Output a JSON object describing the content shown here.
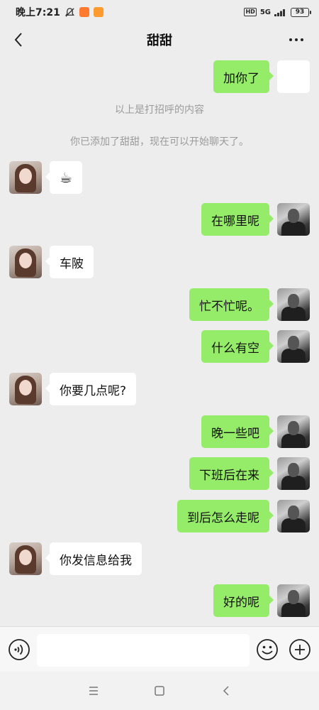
{
  "status_bar": {
    "time": "晚上7:21",
    "network": "5G",
    "hd": "HD",
    "battery": "93"
  },
  "header": {
    "title": "甜甜"
  },
  "messages": [
    {
      "side": "right",
      "text": "加你了",
      "avatar": "blank"
    },
    {
      "side": "system",
      "text": "以上是打招呼的内容"
    },
    {
      "side": "system",
      "text": "你已添加了甜甜，现在可以开始聊天了。"
    },
    {
      "side": "left",
      "text": "☕"
    },
    {
      "side": "right",
      "text": "在哪里呢"
    },
    {
      "side": "left",
      "text": "车陂"
    },
    {
      "side": "right",
      "text": "忙不忙呢。"
    },
    {
      "side": "right",
      "text": "什么有空"
    },
    {
      "side": "left",
      "text": "你要几点呢?"
    },
    {
      "side": "right",
      "text": "晚一些吧"
    },
    {
      "side": "right",
      "text": "下班后在来"
    },
    {
      "side": "right",
      "text": "到后怎么走呢"
    },
    {
      "side": "left",
      "text": "你发信息给我"
    },
    {
      "side": "right",
      "text": "好的呢"
    }
  ],
  "input": {
    "value": "",
    "placeholder": ""
  },
  "icons": {
    "back": "chevron-left-icon",
    "more": "more-dots-icon",
    "voice": "voice-icon",
    "emoji": "emoji-icon",
    "plus": "plus-icon",
    "nav_menu": "menu-lines-icon",
    "nav_home": "square-home-icon",
    "nav_back": "triangle-back-icon"
  },
  "colors": {
    "background": "#ededed",
    "my_bubble": "#95ec69",
    "their_bubble": "#ffffff",
    "system_text": "#9b9b9b"
  }
}
